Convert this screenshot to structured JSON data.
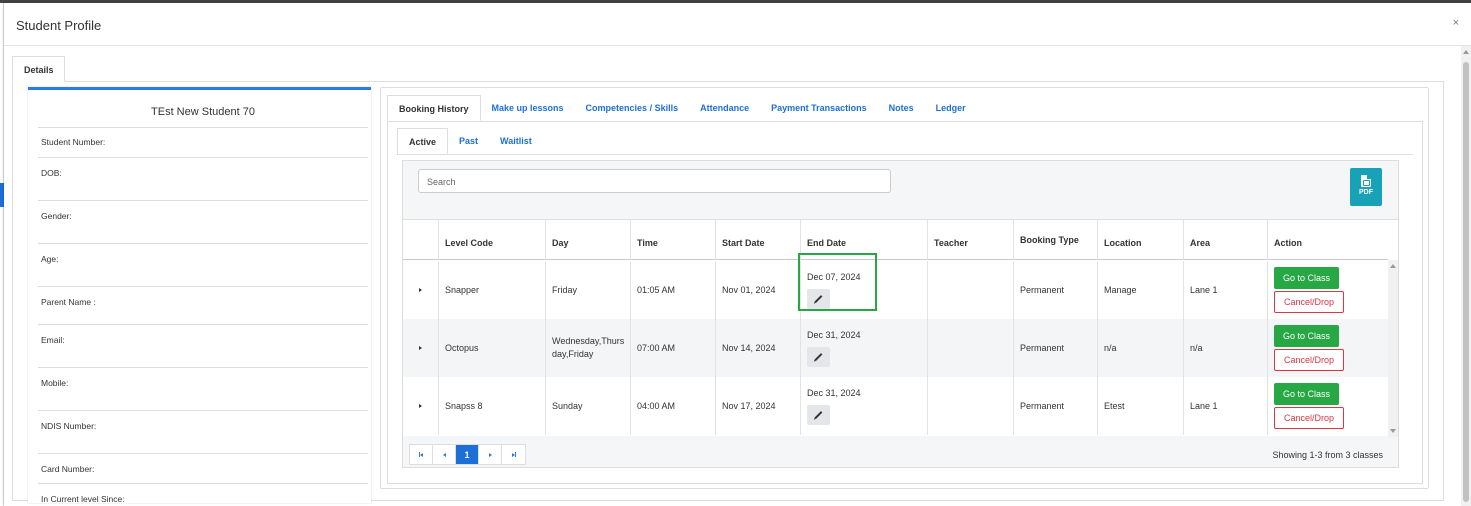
{
  "modal": {
    "title": "Student Profile",
    "close": "×",
    "outer_tab": "Details"
  },
  "student": {
    "name": "TEst New Student 70",
    "fields": [
      "Student Number:",
      "DOB:",
      "Gender:",
      "Age:",
      "Parent Name :",
      "Email:",
      "Mobile:",
      "NDIS Number:",
      "Card Number:",
      "In Current level Since:"
    ]
  },
  "main_tabs": [
    "Booking History",
    "Make up lessons",
    "Competencies / Skills",
    "Attendance",
    "Payment Transactions",
    "Notes",
    "Ledger"
  ],
  "sub_tabs": [
    "Active",
    "Past",
    "Waitlist"
  ],
  "search": {
    "placeholder": "Search"
  },
  "pdf_label": "PDF",
  "table": {
    "headers": [
      "Level Code",
      "Day",
      "Time",
      "Start Date",
      "End Date",
      "Teacher",
      "Booking Type",
      "Location",
      "Area",
      "Action"
    ],
    "rows": [
      {
        "level_code": "Snapper",
        "day": "Friday",
        "time": "01:05 AM",
        "start_date": "Nov 01, 2024",
        "end_date": "Dec 07, 2024",
        "teacher": "",
        "booking_type": "Permanent",
        "location": "Manage",
        "area": "Lane 1"
      },
      {
        "level_code": "Octopus",
        "day": "Wednesday,Thursday,Friday",
        "time": "07:00 AM",
        "start_date": "Nov 14, 2024",
        "end_date": "Dec 31, 2024",
        "teacher": "",
        "booking_type": "Permanent",
        "location": "n/a",
        "area": "n/a"
      },
      {
        "level_code": "Snapss 8",
        "day": "Sunday",
        "time": "04:00 AM",
        "start_date": "Nov 17, 2024",
        "end_date": "Dec 31, 2024",
        "teacher": "",
        "booking_type": "Permanent",
        "location": "Etest",
        "area": "Lane 1"
      }
    ],
    "go_label": "Go to Class",
    "cancel_label": "Cancel/Drop"
  },
  "pager": {
    "current": "1",
    "showing": "Showing 1-3 from 3 classes"
  }
}
